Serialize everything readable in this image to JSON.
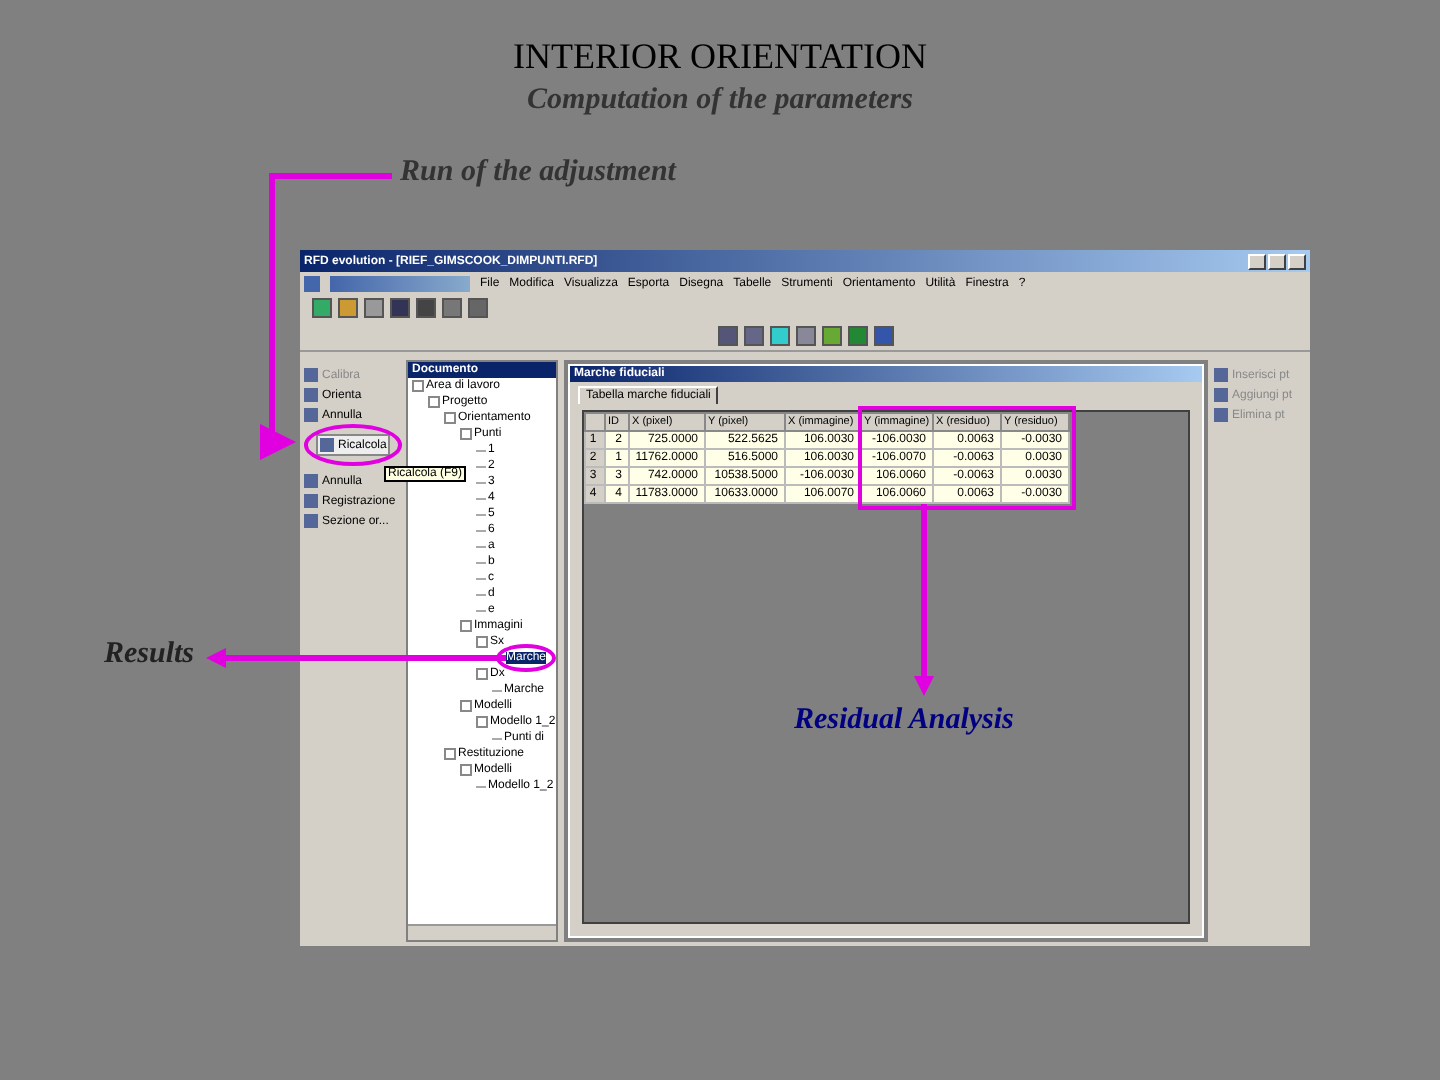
{
  "slide": {
    "title": "INTERIOR ORIENTATION",
    "subtitle": "Computation of the parameters",
    "callouts": [
      {
        "kind": "run",
        "text": "Run of the adjustment"
      },
      {
        "kind": "results",
        "text": "Results"
      },
      {
        "kind": "residual",
        "text": "Residual Analysis"
      }
    ]
  },
  "window": {
    "title": "RFD evolution - [RIEF_GIMSCOOK_DIMPUNTI.RFD]"
  },
  "menu": [
    "File",
    "Modifica",
    "Visualizza",
    "Esporta",
    "Disegna",
    "Tabelle",
    "Strumenti",
    "Orientamento",
    "Utilità",
    "Finestra",
    "?"
  ],
  "commands": [
    {
      "label": "Calibra",
      "disabled": true,
      "selected": false
    },
    {
      "label": "Orienta",
      "disabled": false,
      "selected": false
    },
    {
      "label": "Annulla",
      "disabled": false,
      "selected": false
    },
    {
      "label": "Ricalcola",
      "disabled": false,
      "selected": true
    },
    {
      "label": "Annulla",
      "disabled": false,
      "selected": false
    },
    {
      "label": "Registrazione",
      "disabled": false,
      "selected": false
    },
    {
      "label": "Sezione or...",
      "disabled": false,
      "selected": false
    }
  ],
  "tooltip": "Ricalcola (F9)",
  "document_panel": {
    "title": "Documento",
    "tree": [
      {
        "label": "Area di lavoro",
        "selected": false,
        "children": [
          {
            "label": "Progetto",
            "selected": false,
            "children": [
              {
                "label": "Orientamento",
                "selected": false,
                "children": [
                  {
                    "label": "Punti",
                    "selected": false,
                    "children": [
                      {
                        "label": "1",
                        "selected": false
                      },
                      {
                        "label": "2",
                        "selected": false
                      },
                      {
                        "label": "3",
                        "selected": false
                      },
                      {
                        "label": "4",
                        "selected": false
                      },
                      {
                        "label": "5",
                        "selected": false
                      },
                      {
                        "label": "6",
                        "selected": false
                      },
                      {
                        "label": "a",
                        "selected": false
                      },
                      {
                        "label": "b",
                        "selected": false
                      },
                      {
                        "label": "c",
                        "selected": false
                      },
                      {
                        "label": "d",
                        "selected": false
                      },
                      {
                        "label": "e",
                        "selected": false
                      }
                    ]
                  },
                  {
                    "label": "Immagini",
                    "selected": false,
                    "children": [
                      {
                        "label": "Sx",
                        "selected": false,
                        "children": [
                          {
                            "label": "Marche",
                            "selected": true
                          }
                        ]
                      },
                      {
                        "label": "Dx",
                        "selected": false,
                        "children": [
                          {
                            "label": "Marche",
                            "selected": false
                          }
                        ]
                      }
                    ]
                  },
                  {
                    "label": "Modelli",
                    "selected": false,
                    "children": [
                      {
                        "label": "Modello 1_2",
                        "selected": false,
                        "children": [
                          {
                            "label": "Punti di",
                            "selected": false
                          }
                        ]
                      }
                    ]
                  }
                ]
              },
              {
                "label": "Restituzione",
                "selected": false,
                "children": [
                  {
                    "label": "Modelli",
                    "selected": false,
                    "children": [
                      {
                        "label": "Modello 1_2",
                        "selected": false
                      }
                    ]
                  }
                ]
              }
            ]
          }
        ]
      }
    ]
  },
  "child_window": {
    "title": "Marche fiduciali",
    "tabs": [
      {
        "label": "Tabella marche fiduciali",
        "selected": true
      }
    ],
    "table": {
      "columns": [
        "ID",
        "X (pixel)",
        "Y (pixel)",
        "X (immagine)",
        "Y (immagine)",
        "X (residuo)",
        "Y (residuo)"
      ],
      "rows": [
        {
          "number": "1",
          "cells": [
            "2",
            "725.0000",
            "522.5625",
            "106.0030",
            "-106.0030",
            "0.0063",
            "-0.0030"
          ]
        },
        {
          "number": "2",
          "cells": [
            "1",
            "11762.0000",
            "516.5000",
            "106.0030",
            "-106.0070",
            "-0.0063",
            "0.0030"
          ]
        },
        {
          "number": "3",
          "cells": [
            "3",
            "742.0000",
            "10538.5000",
            "-106.0030",
            "106.0060",
            "-0.0063",
            "0.0030"
          ]
        },
        {
          "number": "4",
          "cells": [
            "4",
            "11783.0000",
            "10633.0000",
            "106.0070",
            "106.0060",
            "0.0063",
            "-0.0030"
          ]
        }
      ]
    }
  },
  "point_commands": [
    {
      "label": "Inserisci pt",
      "disabled": true
    },
    {
      "label": "Aggiungi pt",
      "disabled": true
    },
    {
      "label": "Elimina pt",
      "disabled": true
    }
  ]
}
